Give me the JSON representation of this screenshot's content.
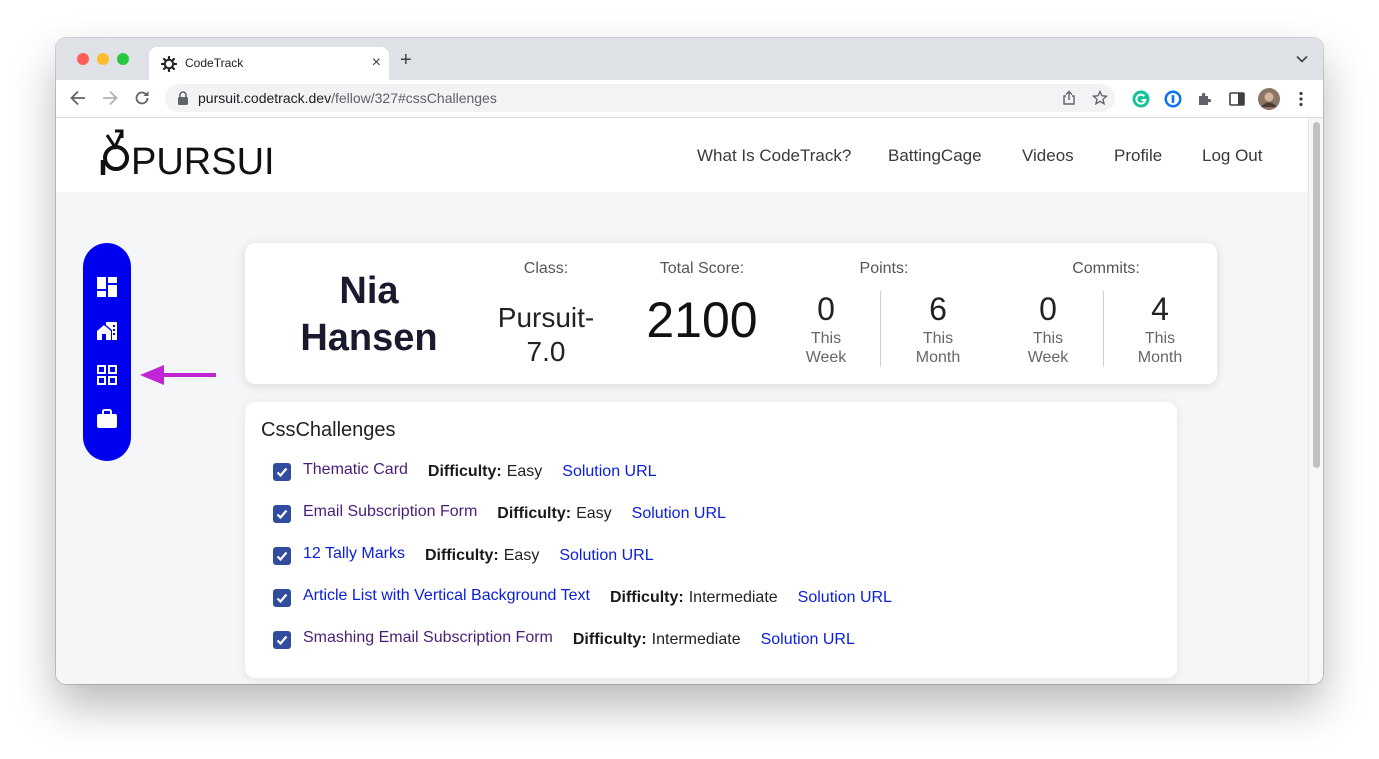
{
  "browser": {
    "tab_title": "CodeTrack",
    "url_domain": "pursuit.codetrack.dev",
    "url_path": "/fellow/327#cssChallenges"
  },
  "site": {
    "logo_text": "PURSUIT",
    "nav": [
      "What Is CodeTrack?",
      "BattingCage",
      "Videos",
      "Profile",
      "Log Out"
    ]
  },
  "sidebar": {
    "icons": [
      "dashboard-icon",
      "home-work-icon",
      "grid-view-icon",
      "briefcase-icon"
    ],
    "active_arrow_color": "#c026d3",
    "background": "#0000f0"
  },
  "profile": {
    "first_name": "Nia",
    "last_name": "Hansen",
    "class_label": "Class:",
    "class_value_line1": "Pursuit-",
    "class_value_line2": "7.0",
    "total_score_label": "Total Score:",
    "total_score": "2100",
    "points_label": "Points:",
    "points_week": "0",
    "points_month": "6",
    "commits_label": "Commits:",
    "commits_week": "0",
    "commits_month": "4",
    "this_label": "This",
    "week_label": "Week",
    "month_label": "Month"
  },
  "challenges": {
    "title": "CssChallenges",
    "difficulty_label": "Difficulty:",
    "solution_label": "Solution URL",
    "items": [
      {
        "name": "Thematic Card",
        "difficulty": "Easy",
        "completed": true,
        "visited": true
      },
      {
        "name": "Email Subscription Form",
        "difficulty": "Easy",
        "completed": true,
        "visited": true
      },
      {
        "name": "12 Tally Marks",
        "difficulty": "Easy",
        "completed": true,
        "visited": false
      },
      {
        "name": "Article List with Vertical Background Text",
        "difficulty": "Intermediate",
        "completed": true,
        "visited": false
      },
      {
        "name": "Smashing Email Subscription Form",
        "difficulty": "Intermediate",
        "completed": true,
        "visited": true
      }
    ]
  }
}
